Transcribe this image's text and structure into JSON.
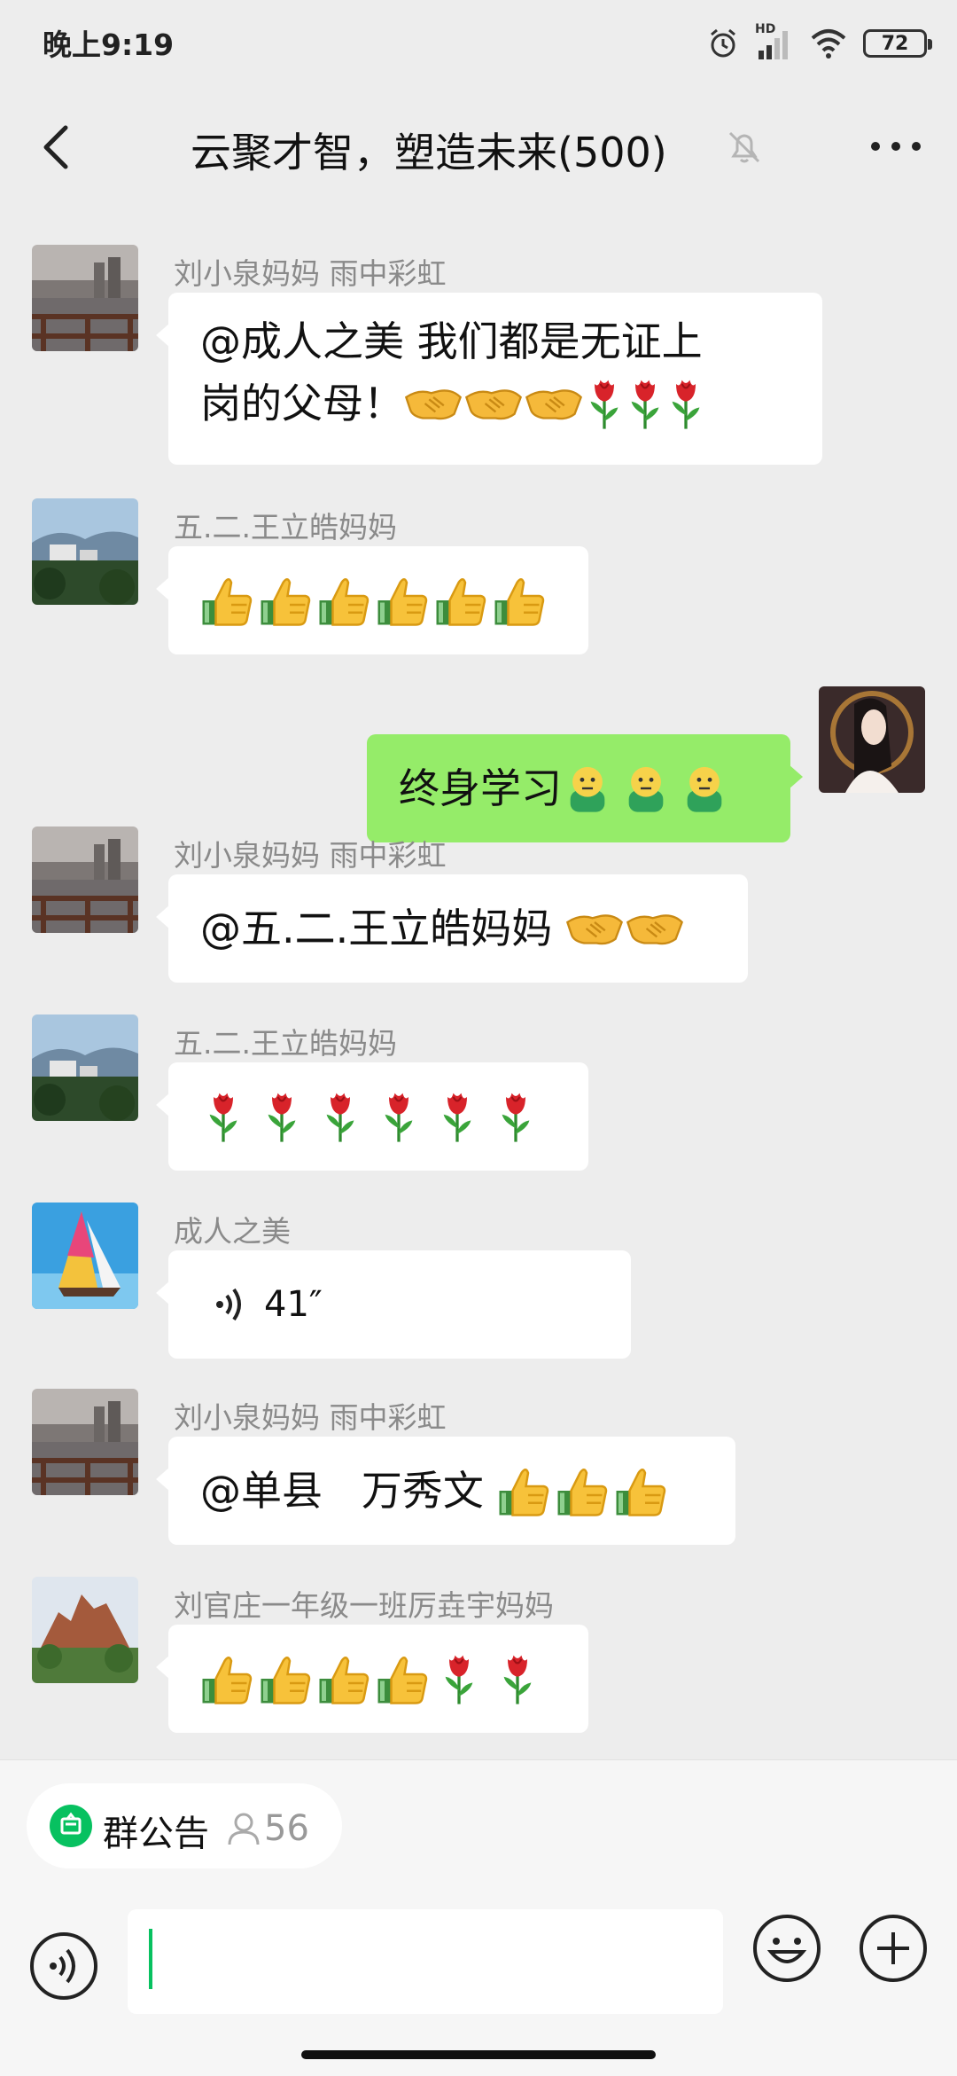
{
  "status": {
    "time": "晚上9:19",
    "battery": "72",
    "network": "HD"
  },
  "header": {
    "title": "云聚才智，塑造未来(500)"
  },
  "messages": [
    {
      "sender": "刘小泉妈妈  雨中彩虹",
      "text_line1": "@成人之美   我们都是无证上",
      "text_line2": "岗的父母！",
      "emojis": [
        "handshake",
        "handshake",
        "handshake",
        "rose",
        "rose",
        "rose"
      ]
    },
    {
      "sender": "五.二.王立皓妈妈",
      "emojis": [
        "thumbs-up",
        "thumbs-up",
        "thumbs-up",
        "thumbs-up",
        "thumbs-up",
        "thumbs-up"
      ]
    },
    {
      "self": true,
      "text": "终身学习",
      "emojis": [
        "person-green",
        "person-green",
        "person-green"
      ]
    },
    {
      "sender": "刘小泉妈妈  雨中彩虹",
      "text": "@五.二.王立皓妈妈 ",
      "emojis": [
        "handshake",
        "handshake"
      ]
    },
    {
      "sender": "五.二.王立皓妈妈",
      "emojis": [
        "rose",
        "rose",
        "rose",
        "rose",
        "rose",
        "rose"
      ]
    },
    {
      "sender": "成人之美",
      "voice_duration": "41″"
    },
    {
      "sender": "刘小泉妈妈  雨中彩虹",
      "text": "@单县   万秀文 ",
      "emojis": [
        "thumbs-up",
        "thumbs-up",
        "thumbs-up"
      ]
    },
    {
      "sender": "刘官庄一年级一班厉垚宇妈妈",
      "emojis": [
        "thumbs-up",
        "thumbs-up",
        "thumbs-up",
        "thumbs-up",
        "rose",
        "rose"
      ]
    }
  ],
  "bottom": {
    "notice_label": "群公告",
    "member_count": "56"
  },
  "colors": {
    "accent": "#07c160",
    "self_bubble": "#95ec69",
    "background": "#ededed"
  }
}
